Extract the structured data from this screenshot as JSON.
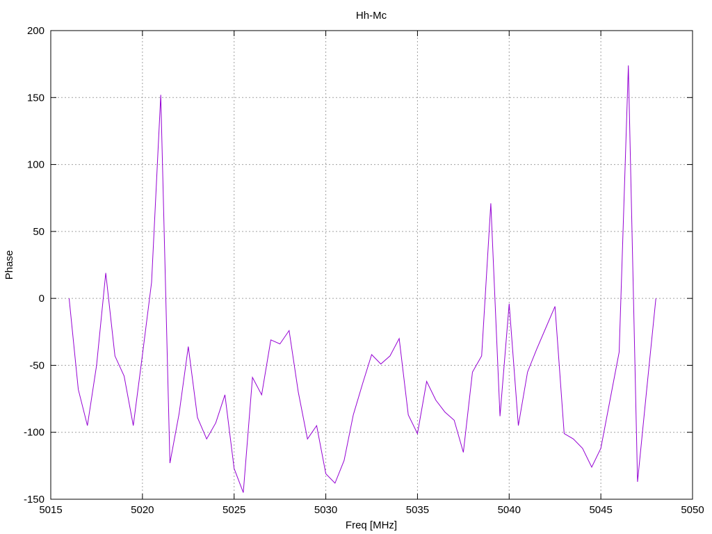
{
  "chart_data": {
    "type": "line",
    "title": "Hh-Mc",
    "xlabel": "Freq [MHz]",
    "ylabel": "Phase",
    "xlim": [
      5015,
      5050
    ],
    "ylim": [
      -150,
      200
    ],
    "xticks": [
      5015,
      5020,
      5025,
      5030,
      5035,
      5040,
      5045,
      5050
    ],
    "yticks": [
      -150,
      -100,
      -50,
      0,
      50,
      100,
      150,
      200
    ],
    "grid": true,
    "line_color": "#9400d3",
    "series": [
      {
        "x": [
          5016,
          5016.5,
          5017,
          5017.5,
          5018,
          5018.5,
          5019,
          5019.5,
          5020,
          5020.5,
          5021,
          5021.5,
          5022,
          5022.5,
          5023,
          5023.5,
          5024,
          5024.5,
          5025,
          5025.5,
          5026,
          5026.5,
          5027,
          5027.5,
          5028,
          5028.5,
          5029,
          5029.5,
          5030,
          5030.5,
          5031,
          5031.5,
          5032,
          5032.5,
          5033,
          5033.5,
          5034,
          5034.5,
          5035,
          5035.5,
          5036,
          5036.5,
          5037,
          5037.5,
          5038,
          5038.5,
          5039,
          5039.5,
          5040,
          5040.5,
          5041,
          5041.5,
          5042,
          5042.5,
          5043,
          5043.5,
          5044,
          5044.5,
          5045,
          5045.5,
          5046,
          5046.5,
          5047,
          5047.5,
          5048
        ],
        "y": [
          0,
          -68,
          -95,
          -50,
          19,
          -43,
          -58,
          -95,
          -42,
          12,
          152,
          -123,
          -86,
          -36,
          -89,
          -105,
          -93,
          -72,
          -127,
          -145,
          -59,
          -72,
          -31,
          -34,
          -24,
          -70,
          -105,
          -95,
          -131,
          -138,
          -121,
          -87,
          -64,
          -42,
          -49,
          -43,
          -30,
          -87,
          -101,
          -62,
          -76,
          -85,
          -91,
          -115,
          -55,
          -43,
          71,
          -88,
          -4,
          -95,
          -55,
          -38,
          -22,
          -6,
          -101,
          -105,
          -112,
          -126,
          -112,
          -76,
          -40,
          174,
          -137,
          -68,
          0
        ]
      }
    ]
  }
}
